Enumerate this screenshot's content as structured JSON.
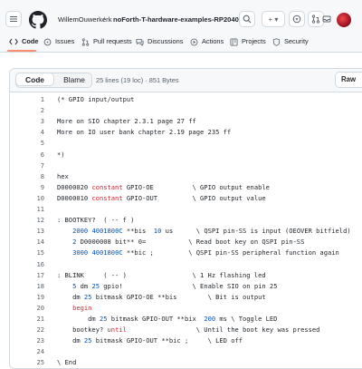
{
  "header": {
    "owner": "WillemOuwerkerk",
    "separator": "/",
    "repo": "noForth-T-hardware-examples-RP2040",
    "plus_label": "+ ▾"
  },
  "tabs": [
    {
      "label": "Code",
      "icon": "code-icon",
      "active": true
    },
    {
      "label": "Issues",
      "icon": "issue-icon"
    },
    {
      "label": "Pull requests",
      "icon": "pull-request-icon"
    },
    {
      "label": "Discussions",
      "icon": "discussions-icon"
    },
    {
      "label": "Actions",
      "icon": "actions-icon"
    },
    {
      "label": "Projects",
      "icon": "projects-icon"
    },
    {
      "label": "Security",
      "icon": "shield-icon"
    }
  ],
  "file": {
    "code_label": "Code",
    "blame_label": "Blame",
    "meta": "25 lines (19 loc) · 851 Bytes",
    "raw_label": "Raw"
  },
  "colors": {
    "keyword": "#cf222e",
    "number": "#0550ae",
    "tab_underline": "#fd8c73"
  },
  "lines": [
    {
      "n": "1",
      "segs": [
        {
          "t": "(* GPIO input/output"
        }
      ]
    },
    {
      "n": "2",
      "segs": []
    },
    {
      "n": "3",
      "segs": [
        {
          "t": "More on SIO chapter 2.3.1 page 27 ff"
        }
      ]
    },
    {
      "n": "4",
      "segs": [
        {
          "t": "More on IO user bank chapter 2.19 page 235 ff"
        }
      ]
    },
    {
      "n": "5",
      "segs": []
    },
    {
      "n": "6",
      "segs": [
        {
          "t": "*)"
        }
      ]
    },
    {
      "n": "7",
      "segs": []
    },
    {
      "n": "8",
      "segs": [
        {
          "t": "hex"
        }
      ]
    },
    {
      "n": "9",
      "segs": [
        {
          "t": "D0000020 "
        },
        {
          "t": "constant",
          "c": "red"
        },
        {
          "t": " GPIO-OE          \\ GPIO output enable"
        }
      ]
    },
    {
      "n": "10",
      "segs": [
        {
          "t": "D0000010 "
        },
        {
          "t": "constant",
          "c": "red"
        },
        {
          "t": " GPIO-OUT         \\ GPIO output value"
        }
      ]
    },
    {
      "n": "11",
      "segs": []
    },
    {
      "n": "12",
      "segs": [
        {
          "t": ": BOOTKEY?  ( -- f )"
        }
      ]
    },
    {
      "n": "13",
      "segs": [
        {
          "t": "    "
        },
        {
          "t": "2000 4001800C",
          "c": "blue"
        },
        {
          "t": " **bis  "
        },
        {
          "t": "10",
          "c": "blue"
        },
        {
          "t": " us      \\ QSPI pin-SS is input (OEOVER bitfield)"
        }
      ]
    },
    {
      "n": "14",
      "segs": [
        {
          "t": "    "
        },
        {
          "t": "2",
          "c": "blue"
        },
        {
          "t": " D0000008 bit** 0=           \\ Read boot key on QSPI pin-SS"
        }
      ]
    },
    {
      "n": "15",
      "segs": [
        {
          "t": "    "
        },
        {
          "t": "3000 4001800C",
          "c": "blue"
        },
        {
          "t": " **bic ;         \\ QSPI pin-SS peripheral function again"
        }
      ]
    },
    {
      "n": "16",
      "segs": []
    },
    {
      "n": "17",
      "segs": [
        {
          "t": ": BLINK     ( -- )                 \\ 1 Hz flashing led"
        }
      ]
    },
    {
      "n": "18",
      "segs": [
        {
          "t": "    "
        },
        {
          "t": "5",
          "c": "blue"
        },
        {
          "t": " dm "
        },
        {
          "t": "25",
          "c": "blue"
        },
        {
          "t": " gpio!                  \\ Enable SIO on pin 25"
        }
      ]
    },
    {
      "n": "19",
      "segs": [
        {
          "t": "    dm "
        },
        {
          "t": "25",
          "c": "blue"
        },
        {
          "t": " bitmask GPIO-OE **bis        \\ Bit is output"
        }
      ]
    },
    {
      "n": "20",
      "segs": [
        {
          "t": "    "
        },
        {
          "t": "begin",
          "c": "red"
        }
      ]
    },
    {
      "n": "21",
      "segs": [
        {
          "t": "        dm "
        },
        {
          "t": "25",
          "c": "blue"
        },
        {
          "t": " bitmask GPIO-OUT **bix  "
        },
        {
          "t": "200",
          "c": "blue"
        },
        {
          "t": " ms \\ Toggle LED"
        }
      ]
    },
    {
      "n": "22",
      "segs": [
        {
          "t": "    bootkey? "
        },
        {
          "t": "until",
          "c": "red"
        },
        {
          "t": "                  \\ Until the boot key was pressed"
        }
      ]
    },
    {
      "n": "23",
      "segs": [
        {
          "t": "    dm "
        },
        {
          "t": "25",
          "c": "blue"
        },
        {
          "t": " bitmask GPIO-OUT **bic ;     \\ LED off"
        }
      ]
    },
    {
      "n": "24",
      "segs": []
    },
    {
      "n": "25",
      "segs": [
        {
          "t": "\\ End"
        }
      ]
    }
  ]
}
